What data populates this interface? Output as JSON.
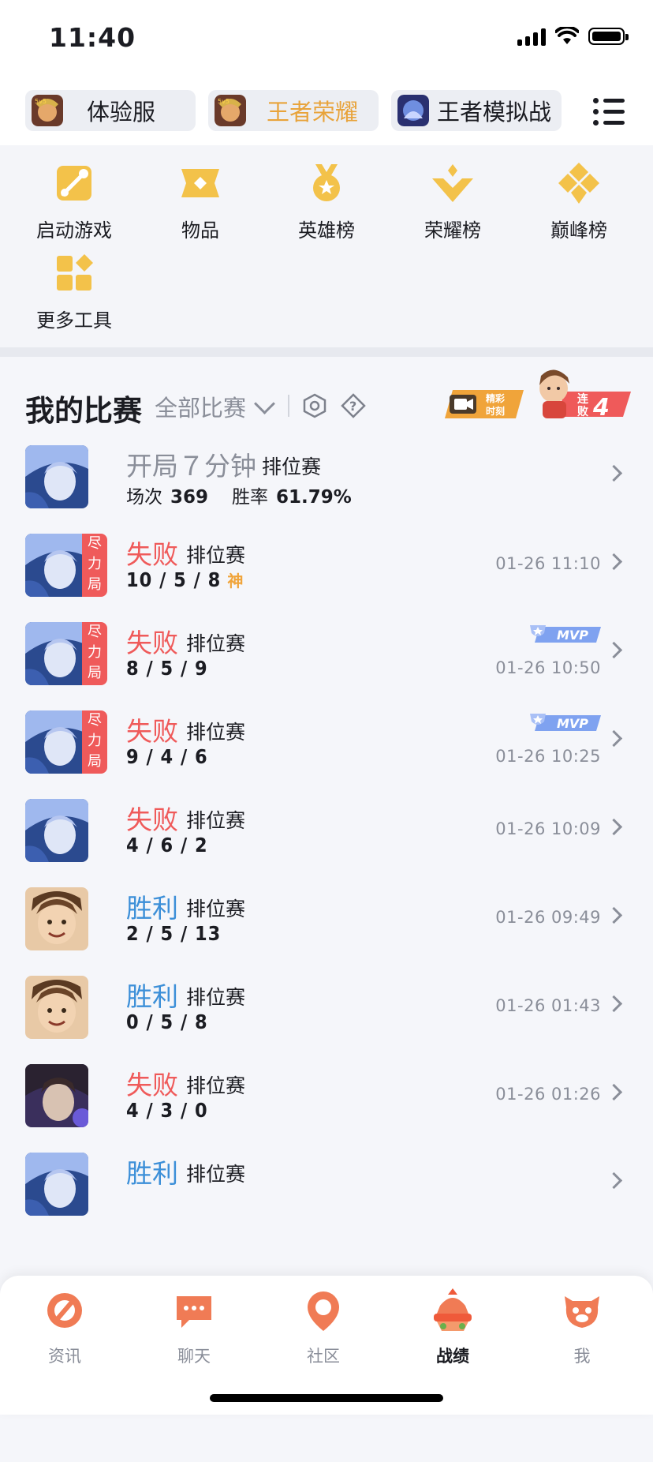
{
  "status": {
    "time": "11:40"
  },
  "game_tabs": [
    {
      "label": "体验服",
      "icon": "game-icon-experience"
    },
    {
      "label": "王者荣耀",
      "icon": "game-icon-honor-of-kings",
      "active": true
    },
    {
      "label": "王者模拟战",
      "icon": "game-icon-auto-chess"
    }
  ],
  "tools": [
    {
      "label": "启动游戏",
      "icon": "launch-game-icon"
    },
    {
      "label": "物品",
      "icon": "items-icon"
    },
    {
      "label": "英雄榜",
      "icon": "hero-rank-icon"
    },
    {
      "label": "荣耀榜",
      "icon": "glory-rank-icon"
    },
    {
      "label": "巅峰榜",
      "icon": "peak-rank-icon"
    },
    {
      "label": "更多工具",
      "icon": "more-tools-icon"
    }
  ],
  "section": {
    "title": "我的比赛",
    "filter": "全部比赛",
    "highlight_badge": {
      "line1": "精彩",
      "line2": "时刻"
    },
    "streak_badge": {
      "text_top": "连",
      "text_bottom": "败",
      "count": "4"
    }
  },
  "summary": {
    "title": "开局７分钟",
    "type": "排位赛",
    "matches_label": "场次",
    "matches": "369",
    "winrate_label": "胜率",
    "winrate": "61.79%"
  },
  "matches": [
    {
      "result": "失败",
      "kind": "loss",
      "type": "排位赛",
      "kda": "10 / 5 / 8",
      "god": "神",
      "time": "01-26 11:10",
      "tag": [
        "尽",
        "力",
        "局"
      ],
      "hero": "blue",
      "mvp": false
    },
    {
      "result": "失败",
      "kind": "loss",
      "type": "排位赛",
      "kda": "8 / 5 / 9",
      "god": "",
      "time": "01-26 10:50",
      "tag": [
        "尽",
        "力",
        "局"
      ],
      "hero": "blue",
      "mvp": true
    },
    {
      "result": "失败",
      "kind": "loss",
      "type": "排位赛",
      "kda": "9 / 4 / 6",
      "god": "",
      "time": "01-26 10:25",
      "tag": [
        "尽",
        "力",
        "局"
      ],
      "hero": "blue",
      "mvp": true
    },
    {
      "result": "失败",
      "kind": "loss",
      "type": "排位赛",
      "kda": "4 / 6 / 2",
      "god": "",
      "time": "01-26 10:09",
      "tag": [],
      "hero": "blue",
      "mvp": false
    },
    {
      "result": "胜利",
      "kind": "win",
      "type": "排位赛",
      "kda": "2 / 5 / 13",
      "god": "",
      "time": "01-26 09:49",
      "tag": [],
      "hero": "brown",
      "mvp": false
    },
    {
      "result": "胜利",
      "kind": "win",
      "type": "排位赛",
      "kda": "0 / 5 / 8",
      "god": "",
      "time": "01-26 01:43",
      "tag": [],
      "hero": "brown",
      "mvp": false
    },
    {
      "result": "失败",
      "kind": "loss",
      "type": "排位赛",
      "kda": "4 / 3 / 0",
      "god": "",
      "time": "01-26 01:26",
      "tag": [],
      "hero": "dark",
      "mvp": false
    },
    {
      "result": "胜利",
      "kind": "win",
      "type": "排位赛",
      "kda": "",
      "god": "",
      "time": "",
      "tag": [],
      "hero": "blue",
      "mvp": false
    }
  ],
  "mvp_label": "MVP",
  "tabbar": [
    {
      "label": "资讯",
      "icon": "news-icon"
    },
    {
      "label": "聊天",
      "icon": "chat-icon"
    },
    {
      "label": "社区",
      "icon": "community-icon"
    },
    {
      "label": "战绩",
      "icon": "records-icon",
      "active": true
    },
    {
      "label": "我",
      "icon": "me-icon"
    }
  ],
  "colors": {
    "loss": "#ef5a5a",
    "win": "#3c8fd8",
    "tool_gold": "#f3c24a",
    "tab_orange": "#f07b55",
    "active_tab_text": "#e8a33a"
  }
}
